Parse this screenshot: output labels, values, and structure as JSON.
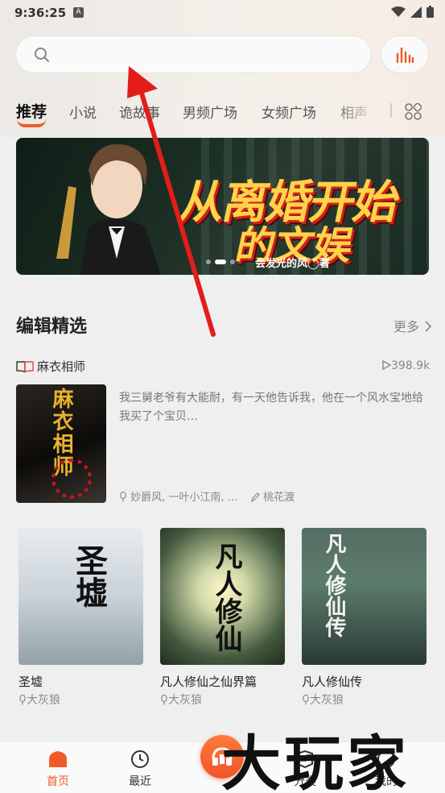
{
  "status_bar": {
    "time": "9:36:25",
    "notif_icon": "A"
  },
  "search": {
    "placeholder": ""
  },
  "tabs": [
    "推荐",
    "小说",
    "诡故事",
    "男频广场",
    "女频广场",
    "相声"
  ],
  "banner": {
    "title_line1": "从离婚开始",
    "title_line2": "的文娱",
    "credit": "会发光的风◯著"
  },
  "editor_section": {
    "title": "编辑精选",
    "more": "更多"
  },
  "featured": {
    "title": "麻衣相师",
    "plays": "398.9k",
    "description": "我三舅老爷有大能耐，有一天他告诉我，他在一个风水宝地给我买了个宝贝…",
    "narrators": "妙爵风, 一叶小江南, …",
    "author": "桃花渡",
    "cover_text": "麻衣相师"
  },
  "books": [
    {
      "name": "圣墟",
      "author": "大灰狼",
      "cover_text": "圣墟"
    },
    {
      "name": "凡人修仙之仙界篇",
      "author": "大灰狼",
      "cover_text": "凡人修仙"
    },
    {
      "name": "凡人修仙传",
      "author": "大灰狼",
      "cover_text": "凡人修仙传"
    }
  ],
  "tabbar": [
    {
      "label": "首页",
      "icon": "home-icon"
    },
    {
      "label": "最近",
      "icon": "clock-icon"
    },
    {
      "label": "分类",
      "icon": "category-icon"
    },
    {
      "label": "我的",
      "icon": "profile-icon"
    }
  ],
  "watermark": "大玩家",
  "colors": {
    "accent": "#f05a28",
    "text_secondary": "#888888"
  }
}
